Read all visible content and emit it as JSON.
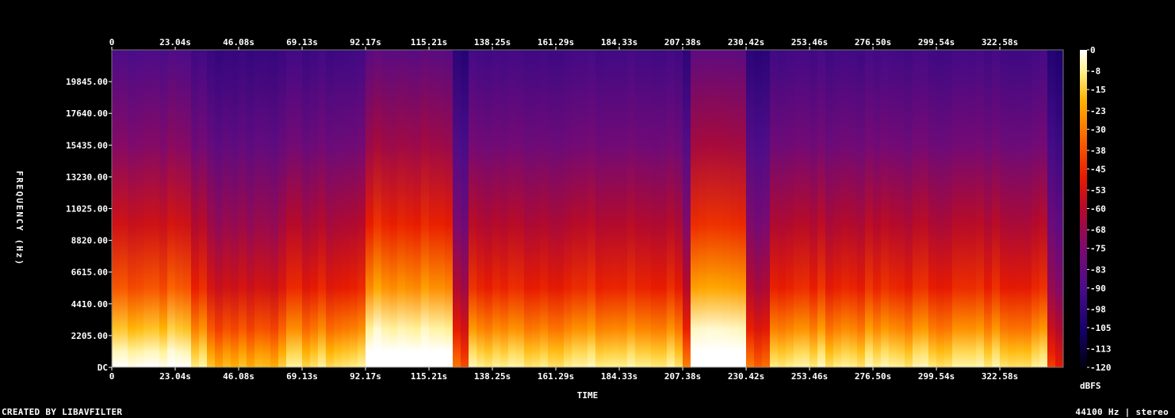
{
  "chart_data": {
    "type": "heatmap",
    "title": "",
    "xlabel": "TIME",
    "ylabel": "FREQUENCY (Hz)",
    "x_ticks": [
      "0",
      "23.04s",
      "46.08s",
      "69.13s",
      "92.17s",
      "115.21s",
      "138.25s",
      "161.29s",
      "184.33s",
      "207.38s",
      "230.42s",
      "253.46s",
      "276.50s",
      "299.54s",
      "322.58s"
    ],
    "y_ticks": [
      "DC",
      "2205.00",
      "4410.00",
      "6615.00",
      "8820.00",
      "11025.00",
      "13230.00",
      "15435.00",
      "17640.00",
      "19845.00"
    ],
    "xlim": [
      0,
      345.6
    ],
    "ylim": [
      0,
      22050
    ],
    "colorbar": {
      "label": "dBFS",
      "ticks": [
        "0",
        "-8",
        "-15",
        "-23",
        "-30",
        "-38",
        "-45",
        "-53",
        "-60",
        "-68",
        "-75",
        "-83",
        "-90",
        "-98",
        "-105",
        "-113",
        "-120"
      ],
      "range": [
        -120,
        0
      ],
      "colors": [
        "#000010",
        "#17006b",
        "#4a0c8a",
        "#7a0a72",
        "#b50a2a",
        "#e81b00",
        "#fb6500",
        "#ffb300",
        "#fff08a",
        "#ffffff"
      ]
    }
  },
  "footer": {
    "left": "CREATED BY LIBAVFILTER",
    "right": "44100 Hz | stereo"
  }
}
